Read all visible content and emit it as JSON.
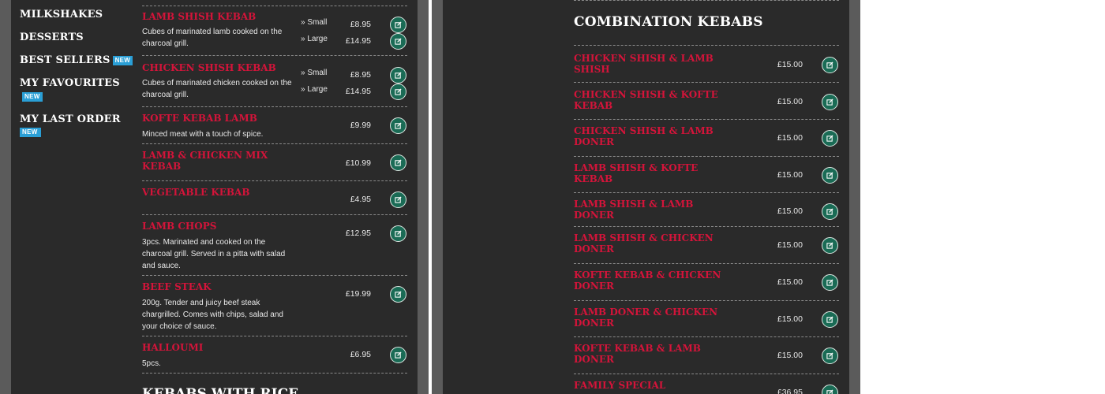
{
  "sidebar": {
    "items": [
      {
        "label": "MILKSHAKES",
        "badge": ""
      },
      {
        "label": "DESSERTS",
        "badge": ""
      },
      {
        "label": "BEST SELLERS",
        "badge": "NEW"
      },
      {
        "label": "MY FAVOURITES",
        "badge": "NEW"
      },
      {
        "label": "MY LAST ORDER",
        "badge": "NEW"
      }
    ]
  },
  "left_menu": {
    "items": [
      {
        "name": "LAMB SHISH KEBAB",
        "desc": "Cubes of marinated lamb cooked on the charcoal grill.",
        "options": [
          {
            "size": "» Small",
            "price": "£8.95"
          },
          {
            "size": "» Large",
            "price": "£14.95"
          }
        ]
      },
      {
        "name": "CHICKEN SHISH KEBAB",
        "desc": "Cubes of marinated chicken cooked on the charcoal grill.",
        "options": [
          {
            "size": "» Small",
            "price": "£8.95"
          },
          {
            "size": "» Large",
            "price": "£14.95"
          }
        ]
      },
      {
        "name": "KOFTE KEBAB LAMB",
        "desc": "Minced meat with a touch of spice.",
        "price": "£9.99"
      },
      {
        "name": "LAMB & CHICKEN MIX KEBAB",
        "desc": "",
        "price": "£10.99"
      },
      {
        "name": "VEGETABLE KEBAB",
        "desc": "",
        "price": "£4.95"
      },
      {
        "name": "LAMB CHOPS",
        "desc": "3pcs. Marinated and cooked on the charcoal grill. Served in a pitta with salad and sauce.",
        "price": "£12.95"
      },
      {
        "name": "BEEF STEAK",
        "desc": "200g. Tender and juicy beef steak chargrilled. Comes with chips, salad and your choice of sauce.",
        "price": "£19.99"
      },
      {
        "name": "HALLOUMI",
        "desc": "5pcs.",
        "price": "£6.95"
      }
    ],
    "next_section_title": "KEBABS WITH RICE"
  },
  "right_menu": {
    "title": "COMBINATION KEBABS",
    "items": [
      {
        "name": "CHICKEN SHISH & LAMB SHISH",
        "price": "£15.00"
      },
      {
        "name": "CHICKEN SHISH & KOFTE KEBAB",
        "price": "£15.00"
      },
      {
        "name": "CHICKEN SHISH & LAMB DONER",
        "price": "£15.00"
      },
      {
        "name": "LAMB SHISH & KOFTE KEBAB",
        "price": "£15.00"
      },
      {
        "name": "LAMB SHISH & LAMB DONER",
        "price": "£15.00"
      },
      {
        "name": "LAMB SHISH & CHICKEN DONER",
        "price": "£15.00"
      },
      {
        "name": "KOFTE KEBAB & CHICKEN DONER",
        "price": "£15.00"
      },
      {
        "name": "LAMB DONER & CHICKEN DONER",
        "price": "£15.00"
      },
      {
        "name": "KOFTE KEBAB & LAMB DONER",
        "price": "£15.00"
      },
      {
        "name": "FAMILY SPECIAL",
        "price": "£36.95"
      }
    ]
  },
  "icons": {
    "add": "edit-square-icon"
  },
  "colors": {
    "accent_red": "#d4143a",
    "button_green": "#1a6b55",
    "badge_blue": "#2a9fd6",
    "panel_bg": "#2a2a2a"
  }
}
